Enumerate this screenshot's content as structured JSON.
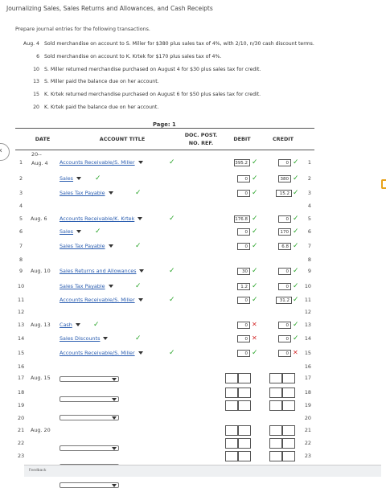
{
  "title": "Journalizing Sales, Sales Returns and Allowances, and Cash Receipts",
  "instructions": "Prepare journal entries for the following transactions.",
  "transactions": [
    {
      "date": "Aug. 4",
      "text": "Sold merchandise on account to S. Miller for $380 plus sales tax of 4%, with 2/10, n/30 cash discount terms."
    },
    {
      "date": "6",
      "text": "Sold merchandise on account to K. Krtek for $170 plus sales tax of 4%."
    },
    {
      "date": "10",
      "text": "S. Miller returned merchandise purchased on August 4 for $30 plus sales tax for credit."
    },
    {
      "date": "13",
      "text": "S. Miller paid the balance due on her account."
    },
    {
      "date": "15",
      "text": "K. Krtek returned merchandise purchased on August 6 for $50 plus sales tax for credit."
    },
    {
      "date": "20",
      "text": "K. Krtek paid the balance due on her account."
    }
  ],
  "journal": {
    "page_label": "Page: 1",
    "headers": {
      "date": "DATE",
      "account": "ACCOUNT TITLE",
      "doc": "DOC. POST.",
      "doc2": "NO. REF.",
      "debit": "DEBIT",
      "credit": "CREDIT"
    },
    "rows": [
      {
        "n": "1",
        "date": "20--",
        "date2": "Aug. 4",
        "acct": "Accounts Receivable/S. Miller",
        "dd": true,
        "acct_ok": true,
        "indent": false,
        "debit": "395.2",
        "debit_ok": true,
        "credit": "0",
        "credit_ok": true
      },
      {
        "n": "2",
        "date": "",
        "acct": "Sales",
        "dd": true,
        "acct_ok": true,
        "indent": true,
        "debit": "0",
        "debit_ok": true,
        "credit": "380",
        "credit_ok": true
      },
      {
        "n": "3",
        "date": "",
        "acct": "Sales Tax Payable",
        "dd": true,
        "acct_ok": true,
        "indent": true,
        "debit": "0",
        "debit_ok": true,
        "credit": "15.2",
        "credit_ok": true
      },
      {
        "n": "4",
        "date": "",
        "acct": "",
        "kind": "blank"
      },
      {
        "n": "5",
        "date": "Aug. 6",
        "acct": "Accounts Receivable/K. Krtek",
        "dd": true,
        "acct_ok": true,
        "indent": false,
        "debit": "176.8",
        "debit_ok": true,
        "credit": "0",
        "credit_ok": true
      },
      {
        "n": "6",
        "date": "",
        "acct": "Sales",
        "dd": true,
        "acct_ok": true,
        "indent": true,
        "debit": "0",
        "debit_ok": true,
        "credit": "170",
        "credit_ok": true
      },
      {
        "n": "7",
        "date": "",
        "acct": "Sales Tax Payable",
        "dd": true,
        "acct_ok": true,
        "indent": true,
        "debit": "0",
        "debit_ok": true,
        "credit": "6.8",
        "credit_ok": true
      },
      {
        "n": "8",
        "date": "",
        "acct": "",
        "kind": "blank"
      },
      {
        "n": "9",
        "date": "Aug. 10",
        "acct": "Sales Returns and Allowances",
        "dd": true,
        "acct_ok": true,
        "indent": false,
        "debit": "30",
        "debit_ok": true,
        "credit": "0",
        "credit_ok": true
      },
      {
        "n": "10",
        "date": "",
        "acct": "Sales Tax Payable",
        "dd": true,
        "acct_ok": true,
        "indent": false,
        "debit": "1.2",
        "debit_ok": true,
        "credit": "0",
        "credit_ok": true
      },
      {
        "n": "11",
        "date": "",
        "acct": "Accounts Receivable/S. Miller",
        "dd": true,
        "acct_ok": true,
        "indent": false,
        "debit": "0",
        "debit_ok": true,
        "credit": "31.2",
        "credit_ok": true
      },
      {
        "n": "12",
        "date": "",
        "acct": "",
        "kind": "blank"
      },
      {
        "n": "13",
        "date": "Aug. 13",
        "acct": "Cash",
        "dd": true,
        "acct_ok": true,
        "indent": false,
        "debit": "0",
        "debit_ok": false,
        "credit": "0",
        "credit_ok": true
      },
      {
        "n": "14",
        "date": "",
        "acct": "Sales Discounts",
        "dd": true,
        "acct_ok": true,
        "indent": false,
        "debit": "0",
        "debit_ok": false,
        "credit": "0",
        "credit_ok": true
      },
      {
        "n": "15",
        "date": "",
        "acct": "Accounts Receivable/S. Miller",
        "dd": true,
        "acct_ok": true,
        "indent": false,
        "debit": "0",
        "debit_ok": true,
        "credit": "0",
        "credit_ok": false
      },
      {
        "n": "16",
        "date": "",
        "acct": "",
        "kind": "blank"
      },
      {
        "n": "17",
        "date": "Aug. 15",
        "acct": "",
        "kind": "empty"
      },
      {
        "n": "18",
        "date": "",
        "acct": "",
        "kind": "empty"
      },
      {
        "n": "19",
        "date": "",
        "acct": "",
        "kind": "empty"
      },
      {
        "n": "20",
        "date": "",
        "acct": "",
        "kind": "blank"
      },
      {
        "n": "21",
        "date": "Aug. 20",
        "acct": "",
        "kind": "empty"
      },
      {
        "n": "22",
        "date": "",
        "acct": "",
        "kind": "empty"
      },
      {
        "n": "23",
        "date": "",
        "acct": "",
        "kind": "empty"
      }
    ]
  },
  "feedback_label": "Feedback",
  "colors": {
    "correct": "#2ba52b",
    "incorrect": "#d32b2b",
    "link": "#2a5db0"
  },
  "icons": {
    "correct": "check-icon",
    "incorrect": "x-icon",
    "dropdown": "chevron-down-icon"
  }
}
